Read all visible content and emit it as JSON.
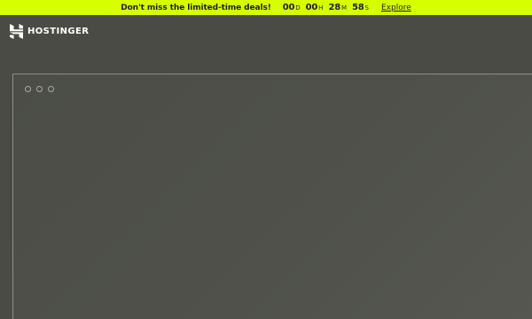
{
  "promo": {
    "text": "Don't miss the limited-time deals!",
    "countdown": [
      {
        "value": "00",
        "unit": "D"
      },
      {
        "value": "00",
        "unit": "H"
      },
      {
        "value": "28",
        "unit": "M"
      },
      {
        "value": "58",
        "unit": "S"
      }
    ],
    "link_label": "Explore"
  },
  "header": {
    "logo_text": "HOSTINGER",
    "logo_icon": "hostinger-h-icon"
  },
  "colors": {
    "accent": "#d6ff00",
    "background": "#4a4b45",
    "text_dark": "#1d1e20"
  }
}
